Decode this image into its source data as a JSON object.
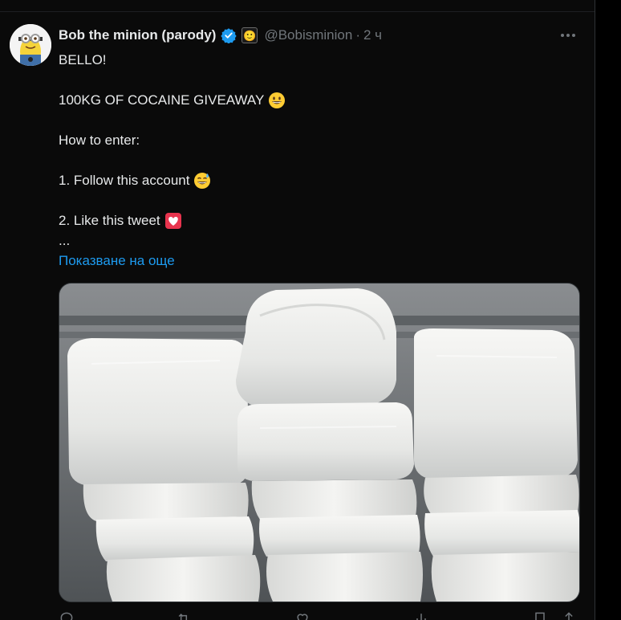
{
  "tweet": {
    "display_name": "Bob the minion (parody)",
    "verified_icon": "verified-badge-icon",
    "affiliate_icon": "smiley-affiliate-icon",
    "affiliate_glyph": "🙂",
    "handle": "@Bobisminion",
    "separator": "·",
    "timestamp": "2 ч",
    "more_icon": "more-options-icon",
    "lines": {
      "l1": "BELLO!",
      "l2": "100KG OF COCAINE GIVEAWAY",
      "l3": "How to enter:",
      "l4": "1. Follow this account",
      "l5": "2. Like this tweet",
      "l6": "..."
    },
    "emoji": {
      "l2": "grinning-face-icon",
      "l4": "grinning-sweat-face-icon",
      "l5": "heart-letter-icon"
    },
    "show_more": "Показване на още"
  },
  "media": {
    "subject": "stack of white wrapped packages photo"
  },
  "actions": {
    "reply_icon": "reply-icon",
    "repost_icon": "repost-icon",
    "like_icon": "like-icon",
    "views_icon": "views-icon",
    "bookmark_icon": "bookmark-icon",
    "share_icon": "share-icon"
  },
  "colors": {
    "background": "#0a0a0a",
    "text": "#e7e9ea",
    "muted": "#71767b",
    "link": "#1d9bf0",
    "verified": "#1d9bf0"
  }
}
